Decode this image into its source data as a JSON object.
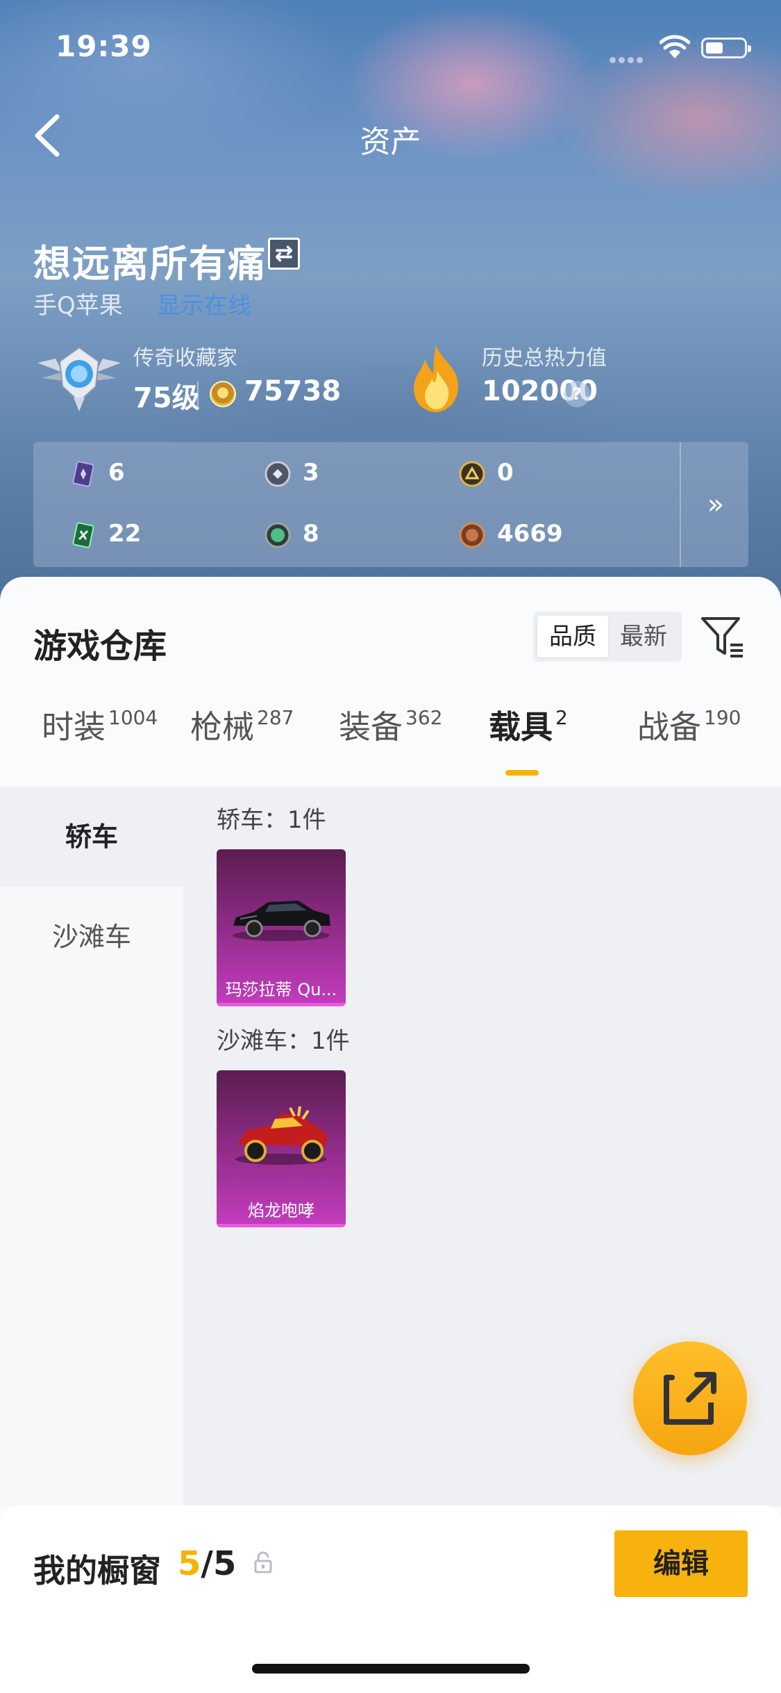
{
  "status_bar": {
    "time": "19:39"
  },
  "nav": {
    "title": "资产"
  },
  "profile": {
    "name": "想远离所有痛",
    "platform": "手Q苹果",
    "online_status": "显示在线"
  },
  "collector": {
    "title": "传奇收藏家",
    "level": "75级",
    "points": "75738"
  },
  "heat": {
    "label": "历史总热力值",
    "value": "102000",
    "help": "?"
  },
  "resources": [
    {
      "icon": "purple-card-icon",
      "value": "6"
    },
    {
      "icon": "silver-medal-icon",
      "value": "3"
    },
    {
      "icon": "gold-badge-icon",
      "value": "0"
    },
    {
      "icon": "green-card-icon",
      "value": "22"
    },
    {
      "icon": "green-orb-icon",
      "value": "8"
    },
    {
      "icon": "bronze-coin-icon",
      "value": "4669"
    }
  ],
  "resources_more": "»",
  "warehouse": {
    "title": "游戏仓库",
    "sort_options": [
      "品质",
      "最新"
    ],
    "active_sort": "品质"
  },
  "tabs": [
    {
      "label": "时装",
      "count": "1004"
    },
    {
      "label": "枪械",
      "count": "287"
    },
    {
      "label": "装备",
      "count": "362"
    },
    {
      "label": "载具",
      "count": "2"
    },
    {
      "label": "战备",
      "count": "190"
    }
  ],
  "active_tab": "载具",
  "side_categories": [
    "轿车",
    "沙滩车"
  ],
  "active_side": "轿车",
  "groups": [
    {
      "title": "轿车：1件",
      "items": [
        {
          "name": "玛莎拉蒂 Qu..."
        }
      ]
    },
    {
      "title": "沙滩车：1件",
      "items": [
        {
          "name": "焰龙咆哮"
        }
      ]
    }
  ],
  "showcase": {
    "label": "我的橱窗",
    "current": "5",
    "separator": "/",
    "total": "5",
    "edit_label": "编辑"
  },
  "colors": {
    "accent": "#f5b400",
    "card_purple": "#c23cbc",
    "link_blue": "#3a8df0"
  }
}
